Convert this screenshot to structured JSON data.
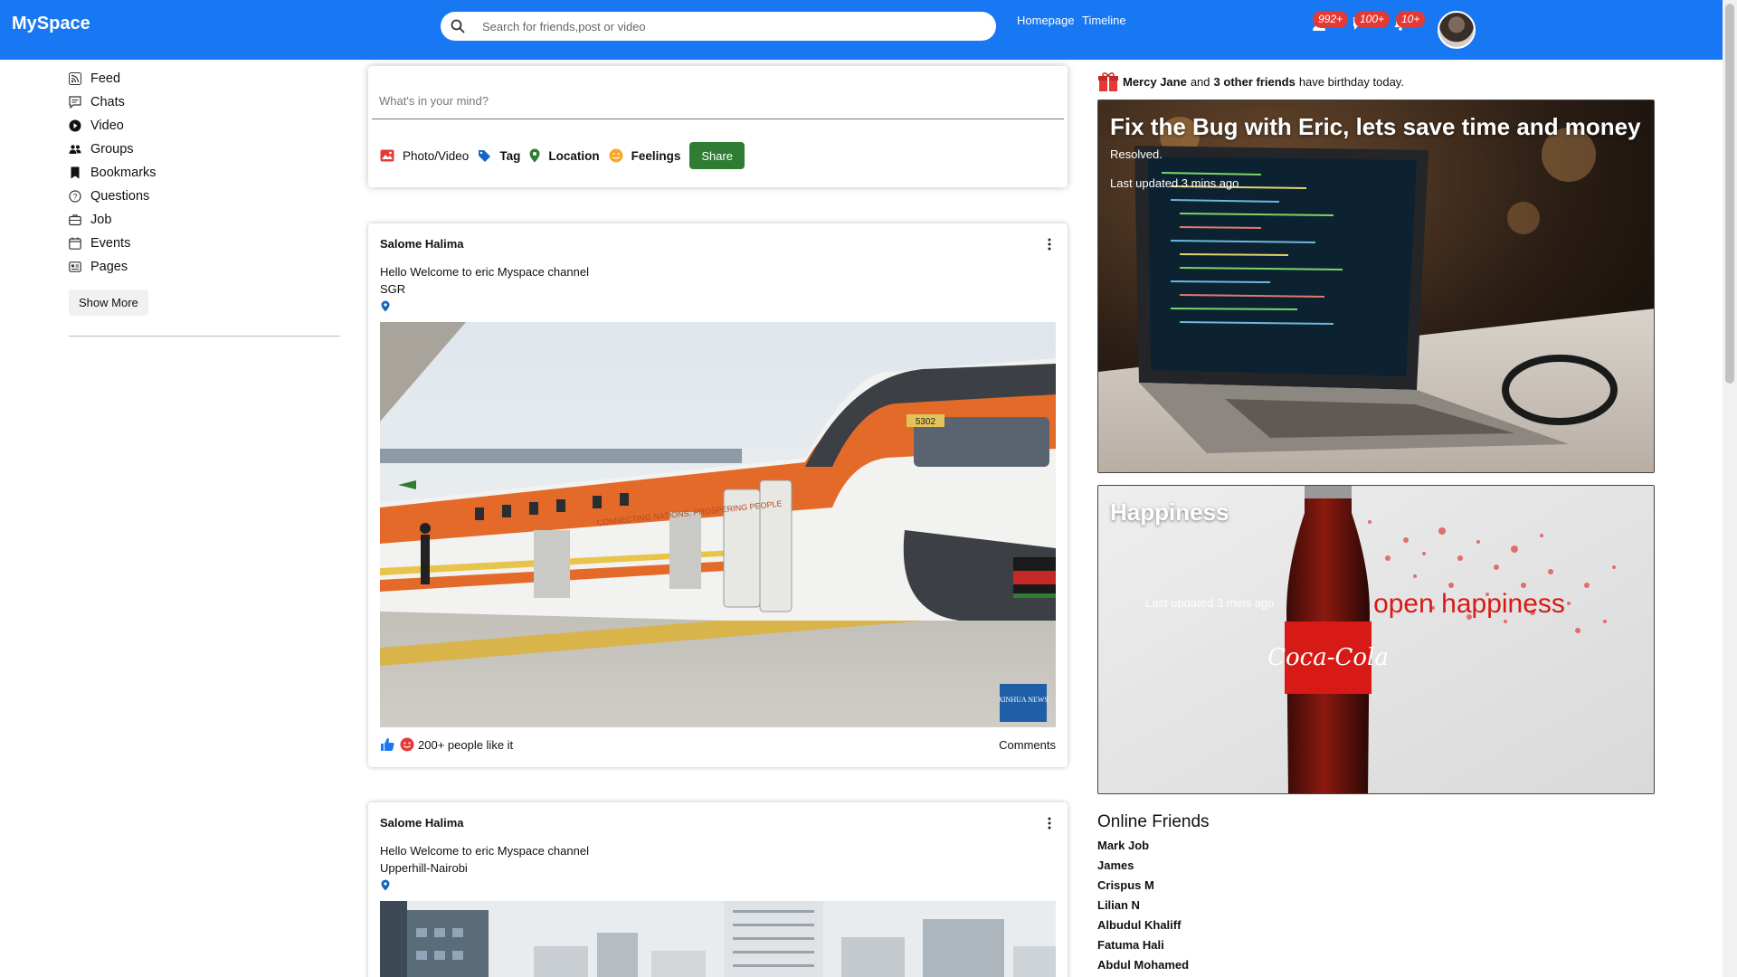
{
  "app": {
    "title": "MySpace"
  },
  "header": {
    "search_placeholder": "Search for friends,post or video",
    "links": [
      "Homepage",
      "Timeline"
    ],
    "badges": {
      "users": "992+",
      "messages": "100+",
      "notifications": "10+"
    }
  },
  "sidebar": {
    "items": [
      {
        "label": "Feed",
        "icon": "rss-icon"
      },
      {
        "label": "Chats",
        "icon": "chat-icon"
      },
      {
        "label": "Video",
        "icon": "play-circle-icon"
      },
      {
        "label": "Groups",
        "icon": "group-icon"
      },
      {
        "label": "Bookmarks",
        "icon": "bookmark-icon"
      },
      {
        "label": "Questions",
        "icon": "question-icon"
      },
      {
        "label": "Job",
        "icon": "briefcase-icon"
      },
      {
        "label": "Events",
        "icon": "calendar-icon"
      },
      {
        "label": "Pages",
        "icon": "pages-icon"
      }
    ],
    "show_more": "Show More"
  },
  "share": {
    "placeholder": "What's in your mind?",
    "options": [
      "Photo/Video",
      "Tag",
      "Location",
      "Feelings"
    ],
    "button": "Share"
  },
  "posts": [
    {
      "author": "Salome Halima",
      "text": "Hello Welcome to eric Myspace channel",
      "location": "SGR",
      "likes": "200+ people like it",
      "comments": "Comments",
      "image_caption": "5302",
      "image_text": "CONNECTING NATIONS, PROSPERING PEOPLE",
      "watermark": "XINHUA NEWS"
    },
    {
      "author": "Salome Halima",
      "text": "Hello Welcome to eric Myspace channel",
      "location": "Upperhill-Nairobi"
    }
  ],
  "rightbar": {
    "birthday": {
      "name": "Mercy Jane",
      "mid": "and",
      "others": "3 other friends",
      "tail": "have birthday today."
    },
    "cards": [
      {
        "title": "Fix the Bug with Eric, lets save time and money",
        "status": "Resolved.",
        "updated": "Last updated 3 mins ago"
      },
      {
        "title": "Happiness",
        "status": ".",
        "updated": "Last updated 3 mins ago",
        "brand": "Coca-Cola",
        "slogan": "open happiness"
      }
    ],
    "online_title": "Online Friends",
    "online_friends": [
      "Mark Job",
      "James",
      "Crispus M",
      "Lilian N",
      "Albudul Khaliff",
      "Fatuma Hali",
      "Abdul Mohamed"
    ]
  },
  "colors": {
    "brand_blue": "#1877f2",
    "share_green": "#2e7d32",
    "badge_red": "#e53935"
  }
}
